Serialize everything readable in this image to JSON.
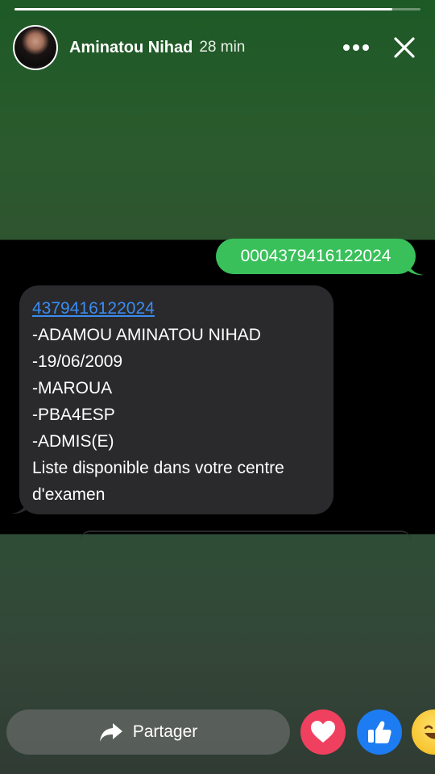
{
  "story": {
    "progress_fraction": 0.93,
    "author_name": "Aminatou Nihad",
    "time_ago": "28 min",
    "more_icon": "more-horizontal-icon",
    "close_icon": "close-icon"
  },
  "chat": {
    "sent_message": "0004379416122024",
    "received_message": {
      "link": "4379416122024",
      "lines": [
        "-ADAMOU AMINATOU NIHAD",
        "-19/06/2009",
        "-MAROUA",
        "-PBA4ESP",
        "-ADMIS(E)",
        "Liste disponible dans votre centre d'examen"
      ]
    },
    "colors": {
      "sent_bubble": "#39c05a",
      "received_bubble": "#2a2a2d",
      "link": "#3b8cf0"
    }
  },
  "footer": {
    "share_label": "Partager",
    "share_icon": "share-arrow-icon",
    "reactions": [
      {
        "name": "love",
        "icon": "heart-icon",
        "color": "#f0405f"
      },
      {
        "name": "like",
        "icon": "thumbs-up-icon",
        "color": "#1d7cf2"
      },
      {
        "name": "haha",
        "icon": "laughing-face-icon",
        "color": "#f7c531"
      }
    ]
  }
}
